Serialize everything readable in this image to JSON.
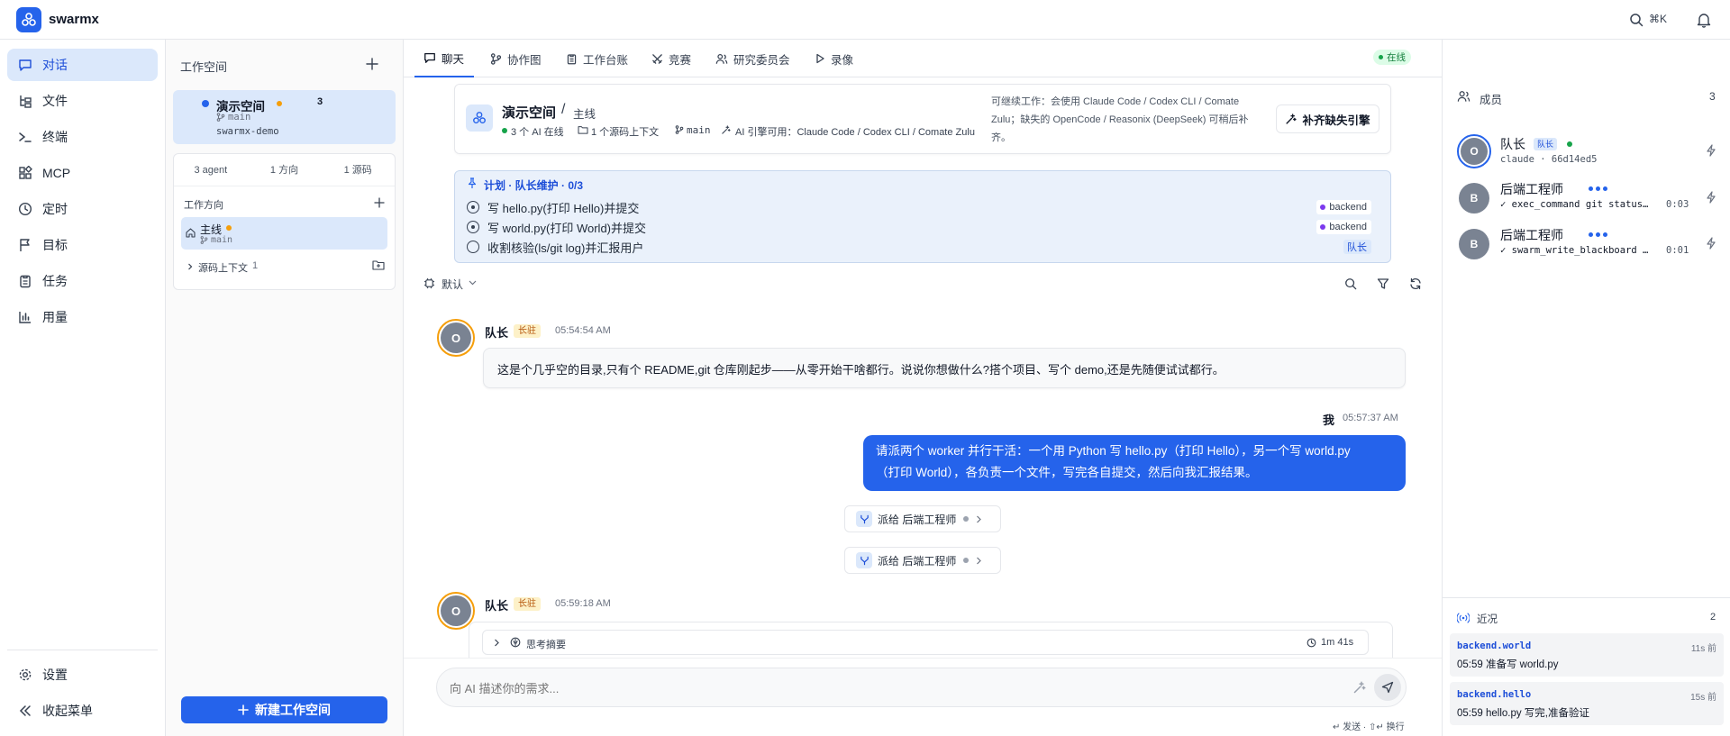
{
  "app": {
    "name": "swarmx",
    "kbd": "⌘K"
  },
  "nav": {
    "items": [
      {
        "label": "对话",
        "icon": "chat-icon"
      },
      {
        "label": "文件",
        "icon": "files-icon"
      },
      {
        "label": "终端",
        "icon": "terminal-icon"
      },
      {
        "label": "MCP",
        "icon": "mcp-icon"
      },
      {
        "label": "定时",
        "icon": "clock-icon"
      },
      {
        "label": "目标",
        "icon": "flag-icon"
      },
      {
        "label": "任务",
        "icon": "clipboard-icon"
      },
      {
        "label": "用量",
        "icon": "chart-icon"
      }
    ],
    "settings": "设置",
    "collapse": "收起菜单"
  },
  "workspace": {
    "title": "工作空间",
    "card": {
      "name": "演示空间",
      "count": "3",
      "branch": "main",
      "path": "swarmx-demo"
    },
    "stats": [
      "3 agent",
      "1 方向",
      "1 源码"
    ],
    "direction_title": "工作方向",
    "direction": {
      "name": "主线",
      "branch": "main"
    },
    "source": {
      "label": "源码上下文",
      "count": "1"
    },
    "new_button": "新建工作空间"
  },
  "tabs": [
    {
      "label": "聊天",
      "icon": "chat-icon"
    },
    {
      "label": "协作图",
      "icon": "graph-icon"
    },
    {
      "label": "工作台账",
      "icon": "ledger-icon"
    },
    {
      "label": "竞赛",
      "icon": "swords-icon"
    },
    {
      "label": "研究委员会",
      "icon": "users-icon"
    },
    {
      "label": "录像",
      "icon": "play-icon"
    }
  ],
  "status_badge": "在线",
  "header": {
    "workspace": "演示空间",
    "sep": "/",
    "direction": "主线",
    "online": "3 个 AI 在线",
    "sources": "1 个源码上下文",
    "branch": "main",
    "engines": "AI 引擎可用：Claude Code / Codex CLI / Comate Zulu",
    "notice_1": "可继续工作：会使用 Claude Code / Codex CLI / Comate",
    "notice_2": "Zulu；缺失的 OpenCode / Reasonix (DeepSeek) 可稍后补",
    "notice_3": "齐。",
    "fix_button": "补齐缺失引擎"
  },
  "plan": {
    "title": "计划 · 队长维护 · 0/3",
    "items": [
      {
        "text": "写 hello.py(打印 Hello)并提交",
        "tag": "backend"
      },
      {
        "text": "写 world.py(打印 World)并提交",
        "tag": "backend"
      },
      {
        "text": "收割核验(ls/git log)并汇报用户",
        "tag": "队长"
      }
    ]
  },
  "filter": {
    "label": "默认"
  },
  "messages": {
    "m1": {
      "avatar": "O",
      "name": "队长",
      "tag": "长驻",
      "time": "05:54:54 AM",
      "text": "这是个几乎空的目录,只有个 README,git 仓库刚起步——从零开始干啥都行。说说你想做什么?搭个项目、写个 demo,还是先随便试试都行。"
    },
    "m2": {
      "name": "我",
      "time": "05:57:37 AM",
      "line1": "请派两个 worker 并行干活：一个用 Python 写 hello.py（打印 Hello），另一个写 world.py",
      "line2": "（打印 World），各负责一个文件，写完各自提交，然后向我汇报结果。"
    },
    "dispatch": [
      "派给 后端工程师",
      "派给 后端工程师"
    ],
    "m3": {
      "avatar": "O",
      "name": "队长",
      "tag": "长驻",
      "time": "05:59:18 AM",
      "think": "思考摘要",
      "think_time": "1m 41s"
    }
  },
  "input": {
    "placeholder": "向 AI 描述你的需求...",
    "hint": "↵ 发送 · ⇧↵ 换行"
  },
  "members": {
    "title": "成员",
    "count": "3",
    "list": [
      {
        "avatar": "O",
        "name": "队长",
        "badge": "队长",
        "detail": "claude · 66d14ed5",
        "time": ""
      },
      {
        "avatar": "B",
        "name": "后端工程师",
        "badge": "",
        "detail": "✓ exec_command git status…",
        "time": "0:03"
      },
      {
        "avatar": "B",
        "name": "后端工程师",
        "badge": "",
        "detail": "✓ swarm_write_blackboard …",
        "time": "0:01"
      }
    ]
  },
  "recent": {
    "title": "近况",
    "count": "2",
    "items": [
      {
        "key": "backend.world",
        "ago": "11s 前",
        "text": "05:59 准备写 world.py"
      },
      {
        "key": "backend.hello",
        "ago": "15s 前",
        "text": "05:59 hello.py 写完,准备验证"
      }
    ]
  },
  "colors": {
    "accent": "#2563eb",
    "online": "#16a34a",
    "busy": "#f59e0b"
  }
}
